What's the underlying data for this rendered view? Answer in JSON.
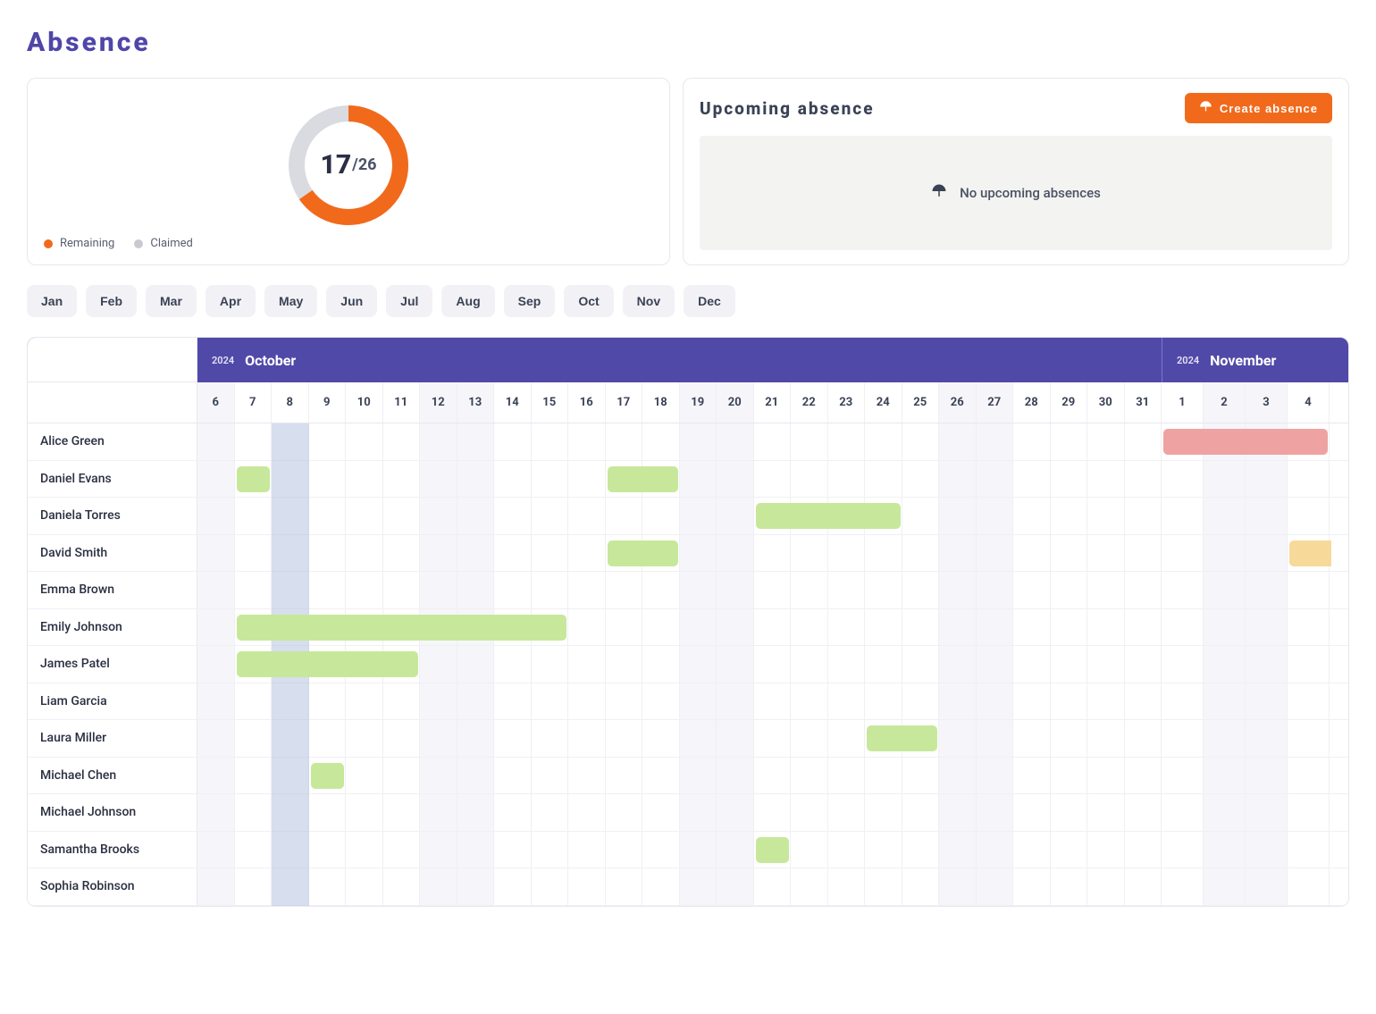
{
  "page": {
    "title": "Absence"
  },
  "allowance": {
    "remaining": 17,
    "total": 26,
    "legend": {
      "remaining": "Remaining",
      "claimed": "Claimed"
    },
    "colors": {
      "remaining": "#F16A1B",
      "claimed": "#C9CAD1"
    }
  },
  "upcoming": {
    "title": "Upcoming absence",
    "empty_text": "No upcoming absences",
    "create_button": "Create absence"
  },
  "months": [
    "Jan",
    "Feb",
    "Mar",
    "Apr",
    "May",
    "Jun",
    "Jul",
    "Aug",
    "Sep",
    "Oct",
    "Nov",
    "Dec"
  ],
  "timeline": {
    "header": {
      "oct_year": "2024",
      "oct_name": "October",
      "nov_year": "2024",
      "nov_name": "November"
    },
    "days": [
      {
        "n": "6",
        "weekend": true
      },
      {
        "n": "7"
      },
      {
        "n": "8"
      },
      {
        "n": "9"
      },
      {
        "n": "10"
      },
      {
        "n": "11"
      },
      {
        "n": "12",
        "weekend": true
      },
      {
        "n": "13",
        "weekend": true
      },
      {
        "n": "14"
      },
      {
        "n": "15"
      },
      {
        "n": "16"
      },
      {
        "n": "17"
      },
      {
        "n": "18"
      },
      {
        "n": "19",
        "weekend": true
      },
      {
        "n": "20",
        "weekend": true
      },
      {
        "n": "21"
      },
      {
        "n": "22"
      },
      {
        "n": "23"
      },
      {
        "n": "24"
      },
      {
        "n": "25"
      },
      {
        "n": "26",
        "weekend": true
      },
      {
        "n": "27",
        "weekend": true
      },
      {
        "n": "28"
      },
      {
        "n": "29"
      },
      {
        "n": "30"
      },
      {
        "n": "31"
      },
      {
        "n": "1",
        "wide": true
      },
      {
        "n": "2",
        "wide": true,
        "weekend": true
      },
      {
        "n": "3",
        "wide": true,
        "weekend": true
      },
      {
        "n": "4",
        "wide": true
      }
    ],
    "people": [
      {
        "name": "Alice Green",
        "bars": [
          {
            "col": 26,
            "span": 4,
            "color": "red",
            "wide": true
          }
        ]
      },
      {
        "name": "Daniel Evans",
        "bars": [
          {
            "col": 1,
            "span": 1,
            "color": "green"
          },
          {
            "col": 11,
            "span": 2,
            "color": "green"
          }
        ]
      },
      {
        "name": "Daniela Torres",
        "bars": [
          {
            "col": 15,
            "span": 4,
            "color": "green"
          }
        ]
      },
      {
        "name": "David Smith",
        "bars": [
          {
            "col": 11,
            "span": 2,
            "color": "green"
          },
          {
            "col": 29,
            "span": 1,
            "color": "yellow",
            "wide": true,
            "openRight": true
          }
        ]
      },
      {
        "name": "Emma Brown",
        "bars": []
      },
      {
        "name": "Emily Johnson",
        "bars": [
          {
            "col": 1,
            "span": 9,
            "color": "green"
          }
        ]
      },
      {
        "name": "James Patel",
        "bars": [
          {
            "col": 1,
            "span": 5,
            "color": "green"
          }
        ]
      },
      {
        "name": "Liam Garcia",
        "bars": []
      },
      {
        "name": "Laura Miller",
        "bars": [
          {
            "col": 18,
            "span": 2,
            "color": "green"
          }
        ]
      },
      {
        "name": "Michael Chen",
        "bars": [
          {
            "col": 3,
            "span": 1,
            "color": "green"
          }
        ]
      },
      {
        "name": "Michael Johnson",
        "bars": []
      },
      {
        "name": "Samantha Brooks",
        "bars": [
          {
            "col": 15,
            "span": 1,
            "color": "green"
          }
        ]
      },
      {
        "name": "Sophia Robinson",
        "bars": []
      }
    ]
  }
}
